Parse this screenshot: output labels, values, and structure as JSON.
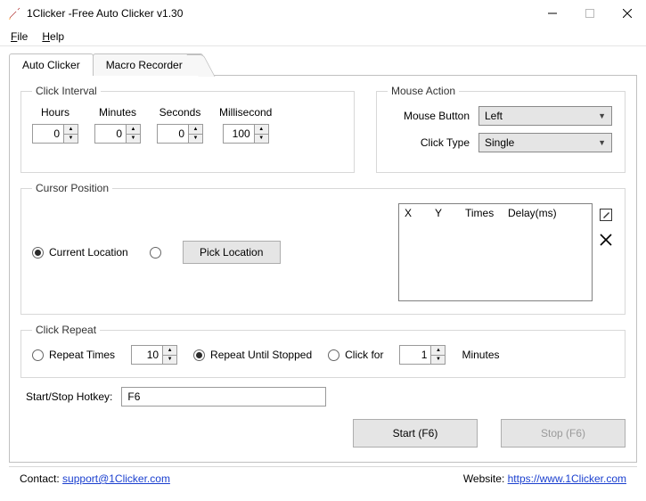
{
  "window": {
    "title": "1Clicker -Free Auto Clicker v1.30"
  },
  "menu": {
    "file": "File",
    "help": "Help"
  },
  "tabs": {
    "auto": "Auto Clicker",
    "macro": "Macro Recorder"
  },
  "interval": {
    "legend": "Click Interval",
    "hours_lbl": "Hours",
    "minutes_lbl": "Minutes",
    "seconds_lbl": "Seconds",
    "ms_lbl": "Millisecond",
    "hours": "0",
    "minutes": "0",
    "seconds": "0",
    "ms": "100"
  },
  "mouse": {
    "legend": "Mouse Action",
    "button_lbl": "Mouse Button",
    "button_val": "Left",
    "type_lbl": "Click Type",
    "type_val": "Single"
  },
  "cursor": {
    "legend": "Cursor Position",
    "current": "Current Location",
    "pick": "Pick Location",
    "cols": {
      "x": "X",
      "y": "Y",
      "times": "Times",
      "delay": "Delay(ms)"
    }
  },
  "repeat": {
    "legend": "Click Repeat",
    "times_lbl": "Repeat Times",
    "times_val": "10",
    "until_lbl": "Repeat Until Stopped",
    "clickfor_lbl": "Click for",
    "clickfor_val": "1",
    "clickfor_unit": "Minutes"
  },
  "hotkey": {
    "label": "Start/Stop Hotkey:",
    "value": "F6"
  },
  "actions": {
    "start": "Start (F6)",
    "stop": "Stop (F6)"
  },
  "footer": {
    "contact_lbl": "Contact:",
    "contact_link": "support@1Clicker.com",
    "website_lbl": "Website:",
    "website_link": "https://www.1Clicker.com"
  }
}
